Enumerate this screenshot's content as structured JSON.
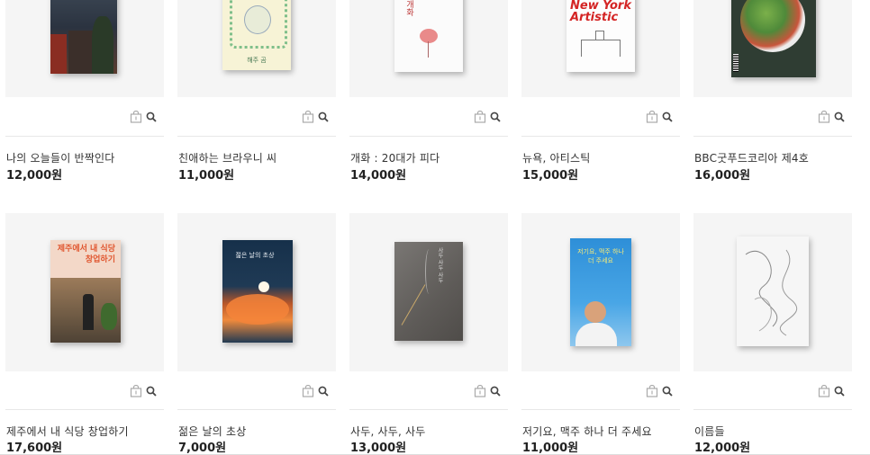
{
  "products": [
    {
      "title": "나의 오늘들이 반짝인다",
      "price": "12,000원",
      "cover": "night-photo-cover"
    },
    {
      "title": "친애하는 브라우니 씨",
      "price": "11,000원",
      "cover": "bear-illustration-cover",
      "cover_text": "해주 곰"
    },
    {
      "title": "개화 : 20대가 피다",
      "price": "14,000원",
      "cover": "flower-cover",
      "cover_text": "개화"
    },
    {
      "title": "뉴욕, 아티스틱",
      "price": "15,000원",
      "cover": "new-york-artistic-cover",
      "cover_text": "New York Artistic"
    },
    {
      "title": "BBC굿푸드코리아 제4호",
      "price": "16,000원",
      "cover": "food-magazine-cover"
    },
    {
      "title": "제주에서 내 식당 창업하기",
      "price": "17,600원",
      "cover": "jeju-restaurant-cover",
      "cover_text": "제주에서 내 식당 창업하기"
    },
    {
      "title": "젊은 날의 초상",
      "price": "7,000원",
      "cover": "sunset-cloud-cover",
      "cover_text": "젊은 날의 초상"
    },
    {
      "title": "사두, 사두, 사두",
      "price": "13,000원",
      "cover": "incense-smoke-cover",
      "cover_text": "사두 사두 사두"
    },
    {
      "title": "저기요, 맥주 하나 더 주세요",
      "price": "11,000원",
      "cover": "sky-portrait-cover",
      "cover_text": "저기요, 맥주 하나 더 주세요"
    },
    {
      "title": "이름들",
      "price": "12,000원",
      "cover": "abstract-line-cover"
    }
  ],
  "icons": {
    "cart": "shopping-bag-icon",
    "zoom": "magnifier-icon"
  },
  "colors": {
    "thumb_bg": "#f5f5f5",
    "divider": "#e7e7e7",
    "price": "#222222",
    "title": "#333333"
  }
}
